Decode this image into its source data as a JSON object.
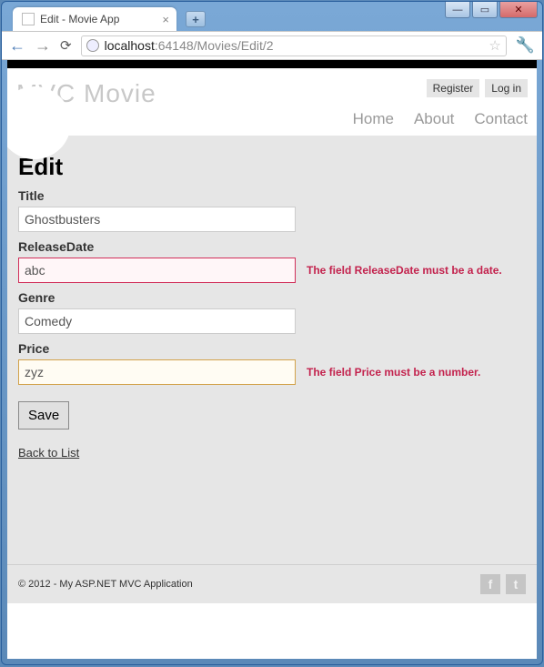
{
  "window": {
    "tab_title": "Edit - Movie App",
    "url_host": "localhost",
    "url_port_path": ":64148/Movies/Edit/2"
  },
  "header": {
    "brand": "MVC Movie",
    "auth": {
      "register": "Register",
      "login": "Log in"
    },
    "nav": {
      "home": "Home",
      "about": "About",
      "contact": "Contact"
    }
  },
  "page": {
    "title": "Edit",
    "fields": {
      "title_label": "Title",
      "title_value": "Ghostbusters",
      "release_label": "ReleaseDate",
      "release_value": "abc",
      "release_error": "The field ReleaseDate must be a date.",
      "genre_label": "Genre",
      "genre_value": "Comedy",
      "price_label": "Price",
      "price_value": "zyz",
      "price_error": "The field Price must be a number."
    },
    "save_label": "Save",
    "back_link": "Back to List"
  },
  "footer": {
    "copyright": "© 2012 - My ASP.NET MVC Application"
  }
}
